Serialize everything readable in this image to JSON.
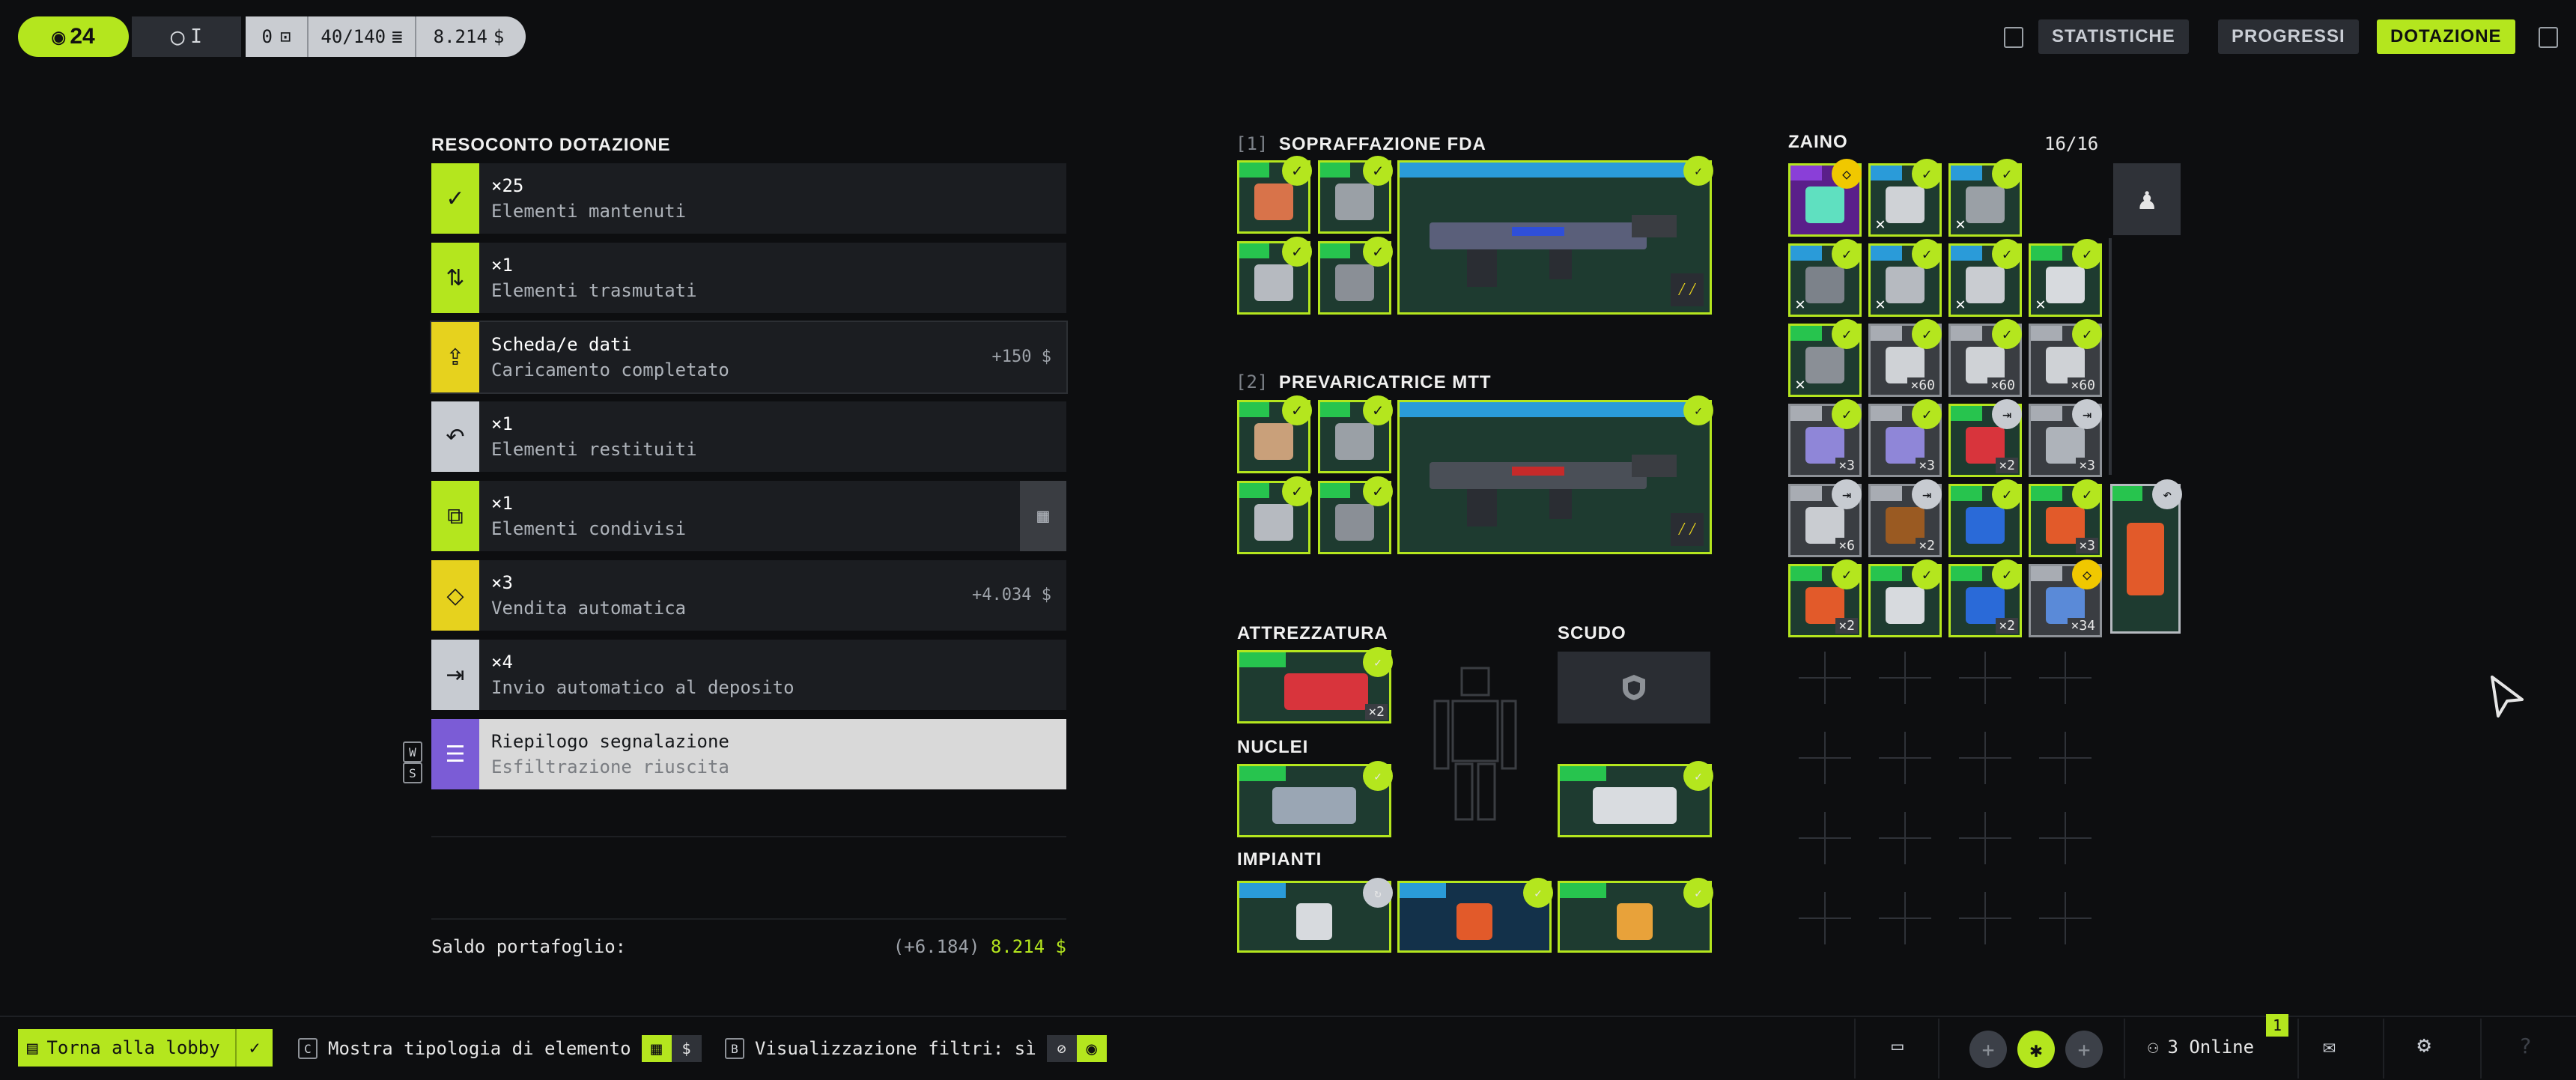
{
  "topbar": {
    "level": "24",
    "rank": "I",
    "counter_a": "0",
    "capacity": "40/140",
    "credits": "8.214",
    "buttons": [
      "STATISTICHE",
      "PROGRESSI",
      "DOTAZIONE"
    ],
    "active_button": "DOTAZIONE"
  },
  "summary": {
    "title": "RESOCONTO DOTAZIONE",
    "rows": [
      {
        "quantity": "×25",
        "label": "Elementi mantenuti",
        "value": "",
        "icon": "check-icon",
        "color": "#b4e61e"
      },
      {
        "quantity": "×1",
        "label": "Elementi trasmutati",
        "value": "",
        "icon": "transmute-icon",
        "color": "#b4e61e"
      },
      {
        "quantity": "Scheda/e dati",
        "label": "Caricamento completato",
        "value": "+150",
        "icon": "upload-icon",
        "color": "#e6d21e"
      },
      {
        "quantity": "×1",
        "label": "Elementi restituiti",
        "value": "",
        "icon": "return-icon",
        "color": "#c7cbd1"
      },
      {
        "quantity": "×1",
        "label": "Elementi condivisi",
        "value": "",
        "icon": "share-icon",
        "color": "#b4e61e"
      },
      {
        "quantity": "×3",
        "label": "Vendita automatica",
        "value": "+4.034",
        "icon": "sell-icon",
        "color": "#e6d21e"
      },
      {
        "quantity": "×4",
        "label": "Invio automatico al deposito",
        "value": "",
        "icon": "deposit-icon",
        "color": "#c7cbd1"
      },
      {
        "quantity": "Riepilogo segnalazione",
        "label": "Esfiltrazione riuscita",
        "value": "",
        "icon": "list-icon",
        "color": "#7b5cd6"
      }
    ],
    "side_keys": [
      "W",
      "S"
    ],
    "wallet_label": "Saldo portafoglio:",
    "wallet_change": "(+6.184)",
    "wallet_total": "8.214"
  },
  "weapons": [
    {
      "index": "[1]",
      "name": "SOPRAFFAZIONE FDA"
    },
    {
      "index": "[2]",
      "name": "PREVARICATRICE MTT"
    }
  ],
  "loadout": {
    "equipment_label": "ATTREZZATURA",
    "equipment_qty": "×2",
    "shield_label": "SCUDO",
    "cores_label": "NUCLEI",
    "implants_label": "IMPIANTI"
  },
  "backpack": {
    "title": "ZAINO",
    "count": "16/16",
    "quantities": [
      "×60",
      "×60",
      "×60",
      "×3",
      "×3",
      "×2",
      "×3",
      "×6",
      "×2",
      "×3",
      "×2",
      "×2",
      "×34"
    ]
  },
  "bottom": {
    "lobby_button": "Torna alla lobby",
    "key_c": "C",
    "item_type_label": "Mostra tipologia di elemento",
    "key_b": "B",
    "filter_label": "Visualizzazione filtri: sì",
    "online_label": "3 Online",
    "notification_count": "1"
  }
}
